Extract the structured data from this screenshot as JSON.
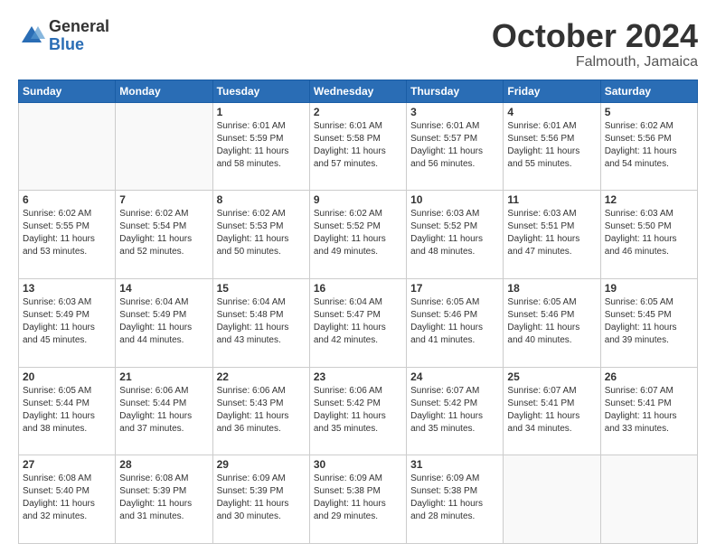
{
  "logo": {
    "general": "General",
    "blue": "Blue"
  },
  "header": {
    "month": "October 2024",
    "location": "Falmouth, Jamaica"
  },
  "weekdays": [
    "Sunday",
    "Monday",
    "Tuesday",
    "Wednesday",
    "Thursday",
    "Friday",
    "Saturday"
  ],
  "weeks": [
    [
      {
        "day": "",
        "info": ""
      },
      {
        "day": "",
        "info": ""
      },
      {
        "day": "1",
        "info": "Sunrise: 6:01 AM\nSunset: 5:59 PM\nDaylight: 11 hours and 58 minutes."
      },
      {
        "day": "2",
        "info": "Sunrise: 6:01 AM\nSunset: 5:58 PM\nDaylight: 11 hours and 57 minutes."
      },
      {
        "day": "3",
        "info": "Sunrise: 6:01 AM\nSunset: 5:57 PM\nDaylight: 11 hours and 56 minutes."
      },
      {
        "day": "4",
        "info": "Sunrise: 6:01 AM\nSunset: 5:56 PM\nDaylight: 11 hours and 55 minutes."
      },
      {
        "day": "5",
        "info": "Sunrise: 6:02 AM\nSunset: 5:56 PM\nDaylight: 11 hours and 54 minutes."
      }
    ],
    [
      {
        "day": "6",
        "info": "Sunrise: 6:02 AM\nSunset: 5:55 PM\nDaylight: 11 hours and 53 minutes."
      },
      {
        "day": "7",
        "info": "Sunrise: 6:02 AM\nSunset: 5:54 PM\nDaylight: 11 hours and 52 minutes."
      },
      {
        "day": "8",
        "info": "Sunrise: 6:02 AM\nSunset: 5:53 PM\nDaylight: 11 hours and 50 minutes."
      },
      {
        "day": "9",
        "info": "Sunrise: 6:02 AM\nSunset: 5:52 PM\nDaylight: 11 hours and 49 minutes."
      },
      {
        "day": "10",
        "info": "Sunrise: 6:03 AM\nSunset: 5:52 PM\nDaylight: 11 hours and 48 minutes."
      },
      {
        "day": "11",
        "info": "Sunrise: 6:03 AM\nSunset: 5:51 PM\nDaylight: 11 hours and 47 minutes."
      },
      {
        "day": "12",
        "info": "Sunrise: 6:03 AM\nSunset: 5:50 PM\nDaylight: 11 hours and 46 minutes."
      }
    ],
    [
      {
        "day": "13",
        "info": "Sunrise: 6:03 AM\nSunset: 5:49 PM\nDaylight: 11 hours and 45 minutes."
      },
      {
        "day": "14",
        "info": "Sunrise: 6:04 AM\nSunset: 5:49 PM\nDaylight: 11 hours and 44 minutes."
      },
      {
        "day": "15",
        "info": "Sunrise: 6:04 AM\nSunset: 5:48 PM\nDaylight: 11 hours and 43 minutes."
      },
      {
        "day": "16",
        "info": "Sunrise: 6:04 AM\nSunset: 5:47 PM\nDaylight: 11 hours and 42 minutes."
      },
      {
        "day": "17",
        "info": "Sunrise: 6:05 AM\nSunset: 5:46 PM\nDaylight: 11 hours and 41 minutes."
      },
      {
        "day": "18",
        "info": "Sunrise: 6:05 AM\nSunset: 5:46 PM\nDaylight: 11 hours and 40 minutes."
      },
      {
        "day": "19",
        "info": "Sunrise: 6:05 AM\nSunset: 5:45 PM\nDaylight: 11 hours and 39 minutes."
      }
    ],
    [
      {
        "day": "20",
        "info": "Sunrise: 6:05 AM\nSunset: 5:44 PM\nDaylight: 11 hours and 38 minutes."
      },
      {
        "day": "21",
        "info": "Sunrise: 6:06 AM\nSunset: 5:44 PM\nDaylight: 11 hours and 37 minutes."
      },
      {
        "day": "22",
        "info": "Sunrise: 6:06 AM\nSunset: 5:43 PM\nDaylight: 11 hours and 36 minutes."
      },
      {
        "day": "23",
        "info": "Sunrise: 6:06 AM\nSunset: 5:42 PM\nDaylight: 11 hours and 35 minutes."
      },
      {
        "day": "24",
        "info": "Sunrise: 6:07 AM\nSunset: 5:42 PM\nDaylight: 11 hours and 35 minutes."
      },
      {
        "day": "25",
        "info": "Sunrise: 6:07 AM\nSunset: 5:41 PM\nDaylight: 11 hours and 34 minutes."
      },
      {
        "day": "26",
        "info": "Sunrise: 6:07 AM\nSunset: 5:41 PM\nDaylight: 11 hours and 33 minutes."
      }
    ],
    [
      {
        "day": "27",
        "info": "Sunrise: 6:08 AM\nSunset: 5:40 PM\nDaylight: 11 hours and 32 minutes."
      },
      {
        "day": "28",
        "info": "Sunrise: 6:08 AM\nSunset: 5:39 PM\nDaylight: 11 hours and 31 minutes."
      },
      {
        "day": "29",
        "info": "Sunrise: 6:09 AM\nSunset: 5:39 PM\nDaylight: 11 hours and 30 minutes."
      },
      {
        "day": "30",
        "info": "Sunrise: 6:09 AM\nSunset: 5:38 PM\nDaylight: 11 hours and 29 minutes."
      },
      {
        "day": "31",
        "info": "Sunrise: 6:09 AM\nSunset: 5:38 PM\nDaylight: 11 hours and 28 minutes."
      },
      {
        "day": "",
        "info": ""
      },
      {
        "day": "",
        "info": ""
      }
    ]
  ]
}
